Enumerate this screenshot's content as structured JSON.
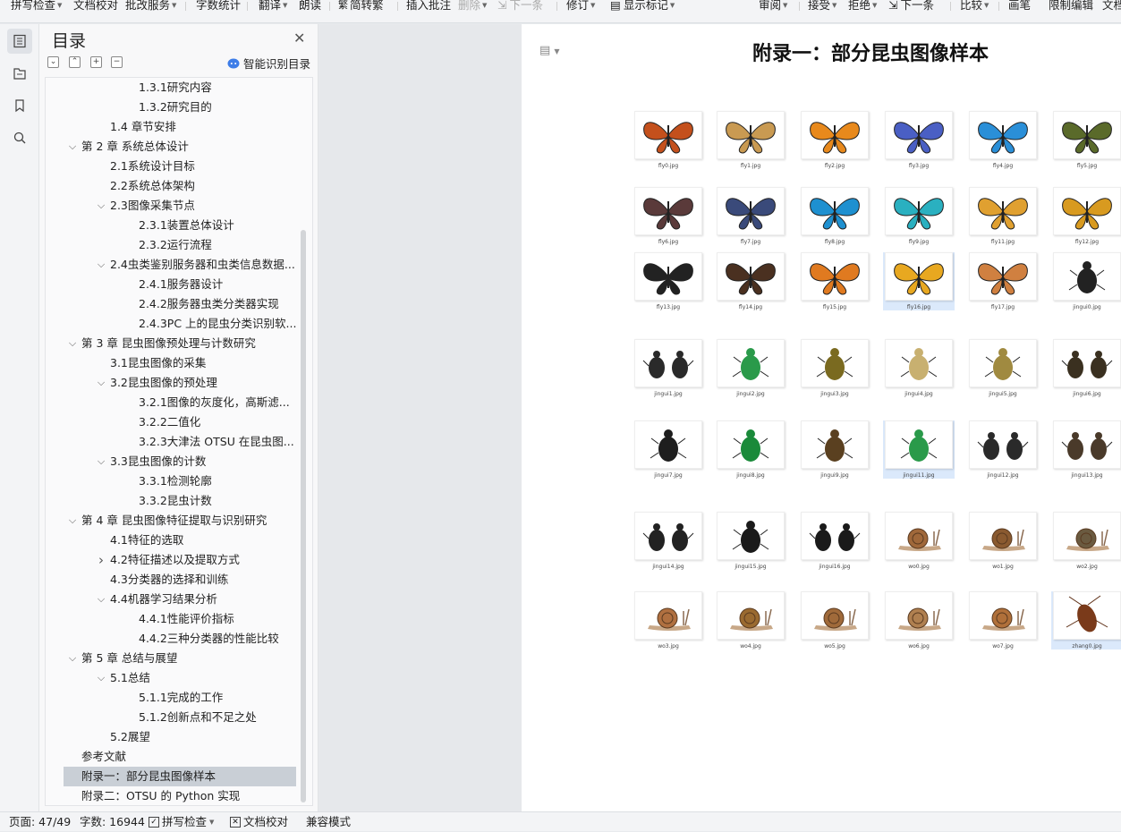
{
  "toolbar": {
    "items": [
      "拼写检查",
      "文档校对",
      "批改服务",
      "字数统计",
      "翻译",
      "朗读",
      "简转繁",
      "插入批注",
      "删除",
      "下一条",
      "修订",
      "显示标记",
      "审阅",
      "接受",
      "拒绝",
      "下一条",
      "比较",
      "画笔",
      "限制编辑",
      "文档"
    ]
  },
  "toc": {
    "title": "目录",
    "ai_label": "智能识别目录",
    "items": [
      {
        "level": 3,
        "text": "1.3.1研究内容"
      },
      {
        "level": 3,
        "text": "1.3.2研究目的"
      },
      {
        "level": 2,
        "text": "1.4 章节安排"
      },
      {
        "level": 1,
        "text": "第 2 章 系统总体设计",
        "chev": "v"
      },
      {
        "level": 2,
        "text": "2.1系统设计目标"
      },
      {
        "level": 2,
        "text": "2.2系统总体架构"
      },
      {
        "level": 2,
        "text": "2.3图像采集节点",
        "chev": "v"
      },
      {
        "level": 3,
        "text": "2.3.1装置总体设计"
      },
      {
        "level": 3,
        "text": "2.3.2运行流程"
      },
      {
        "level": 2,
        "text": "2.4虫类鉴别服务器和虫类信息数据...",
        "chev": "v"
      },
      {
        "level": 3,
        "text": "2.4.1服务器设计"
      },
      {
        "level": 3,
        "text": "2.4.2服务器虫类分类器实现"
      },
      {
        "level": 3,
        "text": "2.4.3PC 上的昆虫分类识别软..."
      },
      {
        "level": 1,
        "text": "第 3 章 昆虫图像预处理与计数研究",
        "chev": "v"
      },
      {
        "level": 2,
        "text": "3.1昆虫图像的采集"
      },
      {
        "level": 2,
        "text": "3.2昆虫图像的预处理",
        "chev": "v"
      },
      {
        "level": 3,
        "text": "3.2.1图像的灰度化，高斯滤..."
      },
      {
        "level": 3,
        "text": "3.2.2二值化"
      },
      {
        "level": 3,
        "text": "3.2.3大津法 OTSU 在昆虫图..."
      },
      {
        "level": 2,
        "text": "3.3昆虫图像的计数",
        "chev": "v"
      },
      {
        "level": 3,
        "text": "3.3.1检测轮廓"
      },
      {
        "level": 3,
        "text": "3.3.2昆虫计数"
      },
      {
        "level": 1,
        "text": "第 4 章 昆虫图像特征提取与识别研究",
        "chev": "v"
      },
      {
        "level": 2,
        "text": "4.1特征的选取"
      },
      {
        "level": 2,
        "text": "4.2特征描述以及提取方式",
        "chev": ">"
      },
      {
        "level": 2,
        "text": "4.3分类器的选择和训练"
      },
      {
        "level": 2,
        "text": "4.4机器学习结果分析",
        "chev": "v"
      },
      {
        "level": 3,
        "text": "4.4.1性能评价指标"
      },
      {
        "level": 3,
        "text": "4.4.2三种分类器的性能比较"
      },
      {
        "level": 1,
        "text": "第 5 章 总结与展望",
        "chev": "v"
      },
      {
        "level": 2,
        "text": "5.1总结",
        "chev": "v"
      },
      {
        "level": 3,
        "text": "5.1.1完成的工作"
      },
      {
        "level": 3,
        "text": "5.1.2创新点和不足之处"
      },
      {
        "level": 2,
        "text": "5.2展望"
      },
      {
        "level": 1,
        "text": "参考文献"
      },
      {
        "level": 1,
        "text": "附录一：部分昆虫图像样本",
        "selected": true
      },
      {
        "level": 1,
        "text": "附录二：OTSU 的 Python 实现"
      }
    ]
  },
  "document": {
    "title": "附录一：部分昆虫图像样本",
    "images": [
      {
        "name": "fly0.jpg",
        "kind": "butterfly",
        "color": "#c4501c"
      },
      {
        "name": "fly1.jpg",
        "kind": "butterfly",
        "color": "#c99a52"
      },
      {
        "name": "fly2.jpg",
        "kind": "butterfly",
        "color": "#e8891c"
      },
      {
        "name": "fly3.jpg",
        "kind": "butterfly",
        "color": "#4a5fc4"
      },
      {
        "name": "fly4.jpg",
        "kind": "butterfly",
        "color": "#2a8fd8"
      },
      {
        "name": "fly5.jpg",
        "kind": "butterfly",
        "color": "#5a6a2a"
      },
      {
        "name": "fly6.jpg",
        "kind": "butterfly",
        "color": "#5a3a3a"
      },
      {
        "name": "fly7.jpg",
        "kind": "butterfly",
        "color": "#3a4a7a"
      },
      {
        "name": "fly8.jpg",
        "kind": "butterfly",
        "color": "#1e90d0"
      },
      {
        "name": "fly9.jpg",
        "kind": "butterfly",
        "color": "#2ab0c0"
      },
      {
        "name": "fly11.jpg",
        "kind": "butterfly",
        "color": "#e0a030"
      },
      {
        "name": "fly12.jpg",
        "kind": "butterfly",
        "color": "#d89a20"
      },
      {
        "name": "fly13.jpg",
        "kind": "butterfly",
        "color": "#222222"
      },
      {
        "name": "fly14.jpg",
        "kind": "butterfly",
        "color": "#4a3020"
      },
      {
        "name": "fly15.jpg",
        "kind": "butterfly",
        "color": "#e07a20"
      },
      {
        "name": "fly16.jpg",
        "kind": "butterfly",
        "color": "#e8a820"
      },
      {
        "name": "fly17.jpg",
        "kind": "butterfly",
        "color": "#d08040"
      },
      {
        "name": "jingui0.jpg",
        "kind": "beetle",
        "color": "#222222"
      },
      {
        "name": "jingui1.jpg",
        "kind": "beetle2",
        "color": "#2a2a2a"
      },
      {
        "name": "jingui2.jpg",
        "kind": "beetle",
        "color": "#2a9a4a"
      },
      {
        "name": "jingui3.jpg",
        "kind": "beetle",
        "color": "#7a6a20"
      },
      {
        "name": "jingui4.jpg",
        "kind": "beetle",
        "color": "#c8b070"
      },
      {
        "name": "jingui5.jpg",
        "kind": "beetle",
        "color": "#a08a40"
      },
      {
        "name": "jingui6.jpg",
        "kind": "beetle2",
        "color": "#3a3020"
      },
      {
        "name": "jingui7.jpg",
        "kind": "beetle",
        "color": "#1e1e1e"
      },
      {
        "name": "jingui8.jpg",
        "kind": "beetle",
        "color": "#1a8a3a"
      },
      {
        "name": "jingui9.jpg",
        "kind": "beetle",
        "color": "#5a4020"
      },
      {
        "name": "jingui11.jpg",
        "kind": "beetle",
        "color": "#2a9a4a"
      },
      {
        "name": "jingui12.jpg",
        "kind": "beetle2",
        "color": "#2a2a2a"
      },
      {
        "name": "jingui13.jpg",
        "kind": "beetle2",
        "color": "#4a3a2a"
      },
      {
        "name": "jingui14.jpg",
        "kind": "beetle2",
        "color": "#222222"
      },
      {
        "name": "jingui15.jpg",
        "kind": "beetle",
        "color": "#1a1a1a"
      },
      {
        "name": "jingui16.jpg",
        "kind": "beetle2",
        "color": "#1a1a1a"
      },
      {
        "name": "wo0.jpg",
        "kind": "snail",
        "color": "#a0683a"
      },
      {
        "name": "wo1.jpg",
        "kind": "snail",
        "color": "#8a5a30"
      },
      {
        "name": "wo2.jpg",
        "kind": "snail",
        "color": "#6a5a40"
      },
      {
        "name": "wo3.jpg",
        "kind": "snail",
        "color": "#b07040"
      },
      {
        "name": "wo4.jpg",
        "kind": "snail",
        "color": "#9a6a30"
      },
      {
        "name": "wo5.jpg",
        "kind": "snail",
        "color": "#a06a3a"
      },
      {
        "name": "wo6.jpg",
        "kind": "snail",
        "color": "#b08050"
      },
      {
        "name": "wo7.jpg",
        "kind": "snail",
        "color": "#b0703a"
      },
      {
        "name": "zhang0.jpg",
        "kind": "roach",
        "color": "#7a3a1a"
      }
    ]
  },
  "status": {
    "page": "页面: 47/49",
    "words": "字数: 16944",
    "spell": "拼写检查",
    "proof": "文档校对",
    "compat": "兼容模式"
  }
}
